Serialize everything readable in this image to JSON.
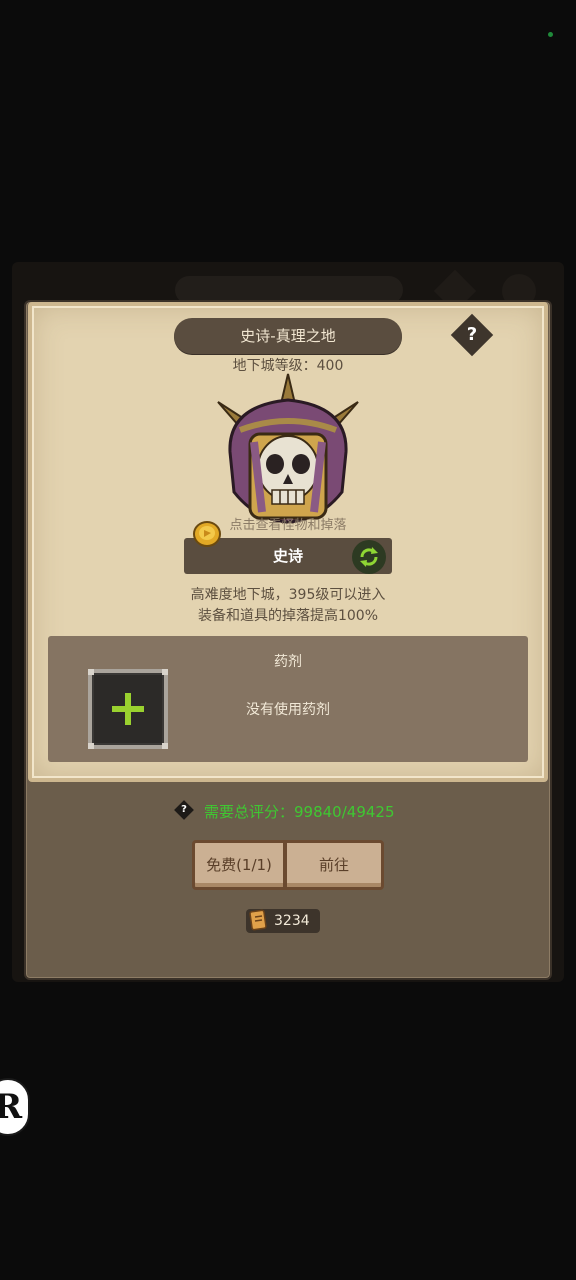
{
  "header": {
    "title": "史诗-真理之地",
    "help_icon": "question-icon",
    "dungeon_level": "地下城等级：400"
  },
  "monster": {
    "icon": "skull-helmet-icon",
    "hint": "点击查看怪物和掉落"
  },
  "difficulty": {
    "label": "史诗",
    "refresh_icon": "refresh-icon",
    "coin_icon": "gold-coin-icon"
  },
  "description": {
    "line1": "高难度地下城，395级可以进入",
    "line2": "装备和道具的掉落提高100%"
  },
  "potion": {
    "title": "药剂",
    "empty_text": "没有使用药剂",
    "add_icon": "plus-icon"
  },
  "score": {
    "text": "需要总评分：99840/49425",
    "color": "#3fc832"
  },
  "buttons": {
    "free": "免费(1/1)",
    "go": "前往"
  },
  "currency": {
    "icon": "scroll-ticket-icon",
    "value": "3234"
  },
  "colors": {
    "parchment": "#e3d3b0",
    "panel": "#857462",
    "accent_green": "#9ad12f"
  }
}
